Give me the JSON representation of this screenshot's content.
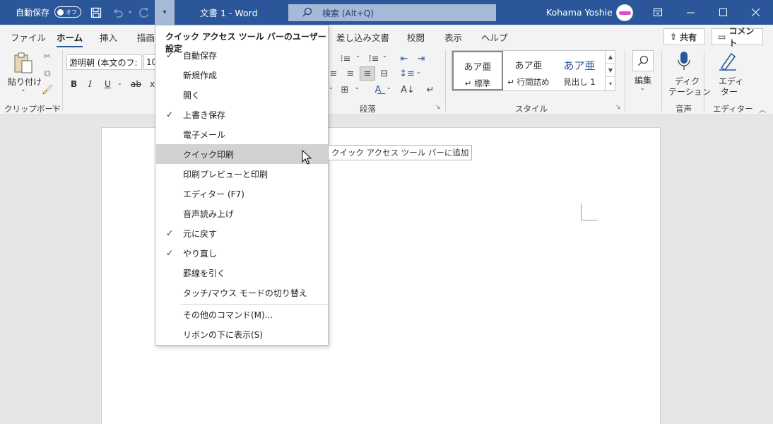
{
  "titlebar": {
    "autosave_label": "自動保存",
    "autosave_state": "オフ",
    "qat_dropdown_glyph": "▾",
    "doc_title": "文書 1  -  Word",
    "search_placeholder": "検索 (Alt+Q)",
    "user_name": "Kohama Yoshie",
    "bg_color": "#2b579a"
  },
  "tabs": [
    {
      "label": "ファイル"
    },
    {
      "label": "ホーム",
      "active": true
    },
    {
      "label": "挿入"
    },
    {
      "label": "描画"
    },
    {
      "label": "差し込み文書"
    },
    {
      "label": "校閲"
    },
    {
      "label": "表示"
    },
    {
      "label": "ヘルプ"
    }
  ],
  "share_button": {
    "label": "共有"
  },
  "comment_button": {
    "label": "コメント"
  },
  "ribbon": {
    "paste_label": "貼り付け",
    "clipboard_group": "クリップボード",
    "font_name": "游明朝 (本文のフ:",
    "font_size": "10",
    "bold": "B",
    "italic": "I",
    "underline": "U",
    "strike": "ab",
    "paragraph_group": "段落",
    "styles_group": "スタイル",
    "styles": [
      {
        "preview": "あア亜",
        "name": "↵ 標準"
      },
      {
        "preview": "あア亜",
        "name": "↵ 行間詰め"
      },
      {
        "preview": "あア亜",
        "name": "見出し 1"
      }
    ],
    "edit_label": "編集",
    "dictate_label1": "ディク",
    "dictate_label2": "テーション",
    "voice_group": "音声",
    "editor_label1": "エディ",
    "editor_label2": "ター",
    "editor_group": "エディター"
  },
  "qat_menu": {
    "title": "クイック アクセス ツール バーのユーザー設定",
    "items": [
      {
        "label": "自動保存",
        "checked": true
      },
      {
        "label": "新規作成",
        "checked": false
      },
      {
        "label": "開く",
        "checked": false
      },
      {
        "label": "上書き保存",
        "checked": true
      },
      {
        "label": "電子メール",
        "checked": false
      },
      {
        "label": "クイック印刷",
        "checked": false,
        "hover": true
      },
      {
        "label": "印刷プレビューと印刷",
        "checked": false
      },
      {
        "label": "エディター (F7)",
        "checked": false
      },
      {
        "label": "音声読み上げ",
        "checked": false
      },
      {
        "label": "元に戻す",
        "checked": true
      },
      {
        "label": "やり直し",
        "checked": true
      },
      {
        "label": "罫線を引く",
        "checked": false
      },
      {
        "label": "タッチ/マウス モードの切り替え",
        "checked": false
      }
    ],
    "more_commands": "その他のコマンド(M)...",
    "show_below": "リボンの下に表示(S)"
  },
  "tooltip": "クイック アクセス ツール バーに追加",
  "check_glyph": "✓"
}
